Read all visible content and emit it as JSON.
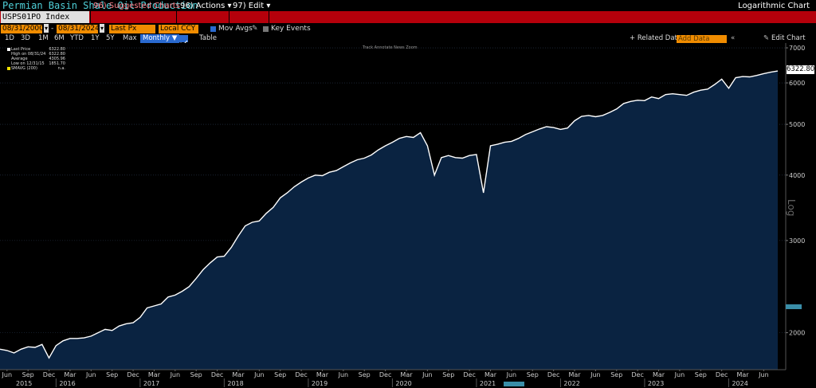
{
  "title": "Permian Basin Shale Oil Production",
  "command_bar": {
    "ticker": "USPS01PO Index",
    "suggested": "96) Suggested Charts",
    "actions": "96) Actions ▾",
    "edit": "97) Edit ▾",
    "mode": "Logarithmic Chart"
  },
  "controls": {
    "start_date": "08/31/2000",
    "end_date": "08/31/2024",
    "field": "Last Px",
    "currency": "Local CCY",
    "mov_avgs": "Mov Avgs",
    "key_events": "Key Events",
    "related_data": "+ Related Dat",
    "add_data_placeholder": "Add Data",
    "edit_chart": "Edit Chart"
  },
  "periods": [
    "1D",
    "3D",
    "1M",
    "6M",
    "YTD",
    "1Y",
    "5Y",
    "Max"
  ],
  "frequency": "Monthly ▼",
  "table_label": "Table",
  "mini_toolbar": "Track   Annotate   News   Zoom",
  "legend": {
    "rows": [
      {
        "label": "Last Price",
        "value": "6322.80"
      },
      {
        "label": "High on 08/31/24",
        "value": "6322.80"
      },
      {
        "label": "Average",
        "value": "4305.96"
      },
      {
        "label": "Low on 12/31/15",
        "value": "1851.70"
      },
      {
        "label": "SMAVG (200)",
        "value": "n.a."
      }
    ]
  },
  "last_value_label": "6322.80",
  "axis_side_label": "Log",
  "colors": {
    "area_fill": "#0a2341",
    "line": "#ffffff",
    "command_bar": "#b5000b",
    "orange_field": "#f08c00",
    "title": "#4fd0d8"
  },
  "chart_data": {
    "type": "area",
    "scale": "log",
    "title": "Permian Basin Shale Oil Production",
    "ylim": [
      1700,
      7100
    ],
    "yticks": [
      2000,
      3000,
      4000,
      5000,
      6000,
      7000
    ],
    "month_labels": [
      "Jun",
      "Sep",
      "Dec",
      "Mar",
      "Jun",
      "Sep",
      "Dec",
      "Mar",
      "Jun",
      "Sep",
      "Dec",
      "Mar",
      "Jun",
      "Sep",
      "Dec",
      "Mar",
      "Jun",
      "Sep",
      "Dec",
      "Mar",
      "Jun",
      "Sep",
      "Dec",
      "Mar",
      "Jun",
      "Sep",
      "Dec",
      "Mar",
      "Jun",
      "Sep",
      "Dec",
      "Mar",
      "Jun",
      "Sep",
      "Dec",
      "Mar",
      "Jun"
    ],
    "year_labels": [
      "2015",
      "2016",
      "2017",
      "2018",
      "2019",
      "2020",
      "2021",
      "2022",
      "2023",
      "2024"
    ],
    "series": [
      {
        "points": [
          [
            "2015-05",
            1860
          ],
          [
            "2015-06",
            1850
          ],
          [
            "2015-07",
            1830
          ],
          [
            "2015-08",
            1860
          ],
          [
            "2015-09",
            1880
          ],
          [
            "2015-10",
            1875
          ],
          [
            "2015-11",
            1900
          ],
          [
            "2015-12",
            1790
          ],
          [
            "2016-01",
            1890
          ],
          [
            "2016-02",
            1930
          ],
          [
            "2016-03",
            1950
          ],
          [
            "2016-04",
            1950
          ],
          [
            "2016-05",
            1955
          ],
          [
            "2016-06",
            1970
          ],
          [
            "2016-07",
            2000
          ],
          [
            "2016-08",
            2030
          ],
          [
            "2016-09",
            2020
          ],
          [
            "2016-10",
            2060
          ],
          [
            "2016-11",
            2080
          ],
          [
            "2016-12",
            2090
          ],
          [
            "2017-01",
            2140
          ],
          [
            "2017-02",
            2230
          ],
          [
            "2017-03",
            2250
          ],
          [
            "2017-04",
            2270
          ],
          [
            "2017-05",
            2340
          ],
          [
            "2017-06",
            2360
          ],
          [
            "2017-07",
            2400
          ],
          [
            "2017-08",
            2450
          ],
          [
            "2017-09",
            2540
          ],
          [
            "2017-10",
            2640
          ],
          [
            "2017-11",
            2720
          ],
          [
            "2017-12",
            2790
          ],
          [
            "2018-01",
            2800
          ],
          [
            "2018-02",
            2910
          ],
          [
            "2018-03",
            3060
          ],
          [
            "2018-04",
            3200
          ],
          [
            "2018-05",
            3250
          ],
          [
            "2018-06",
            3270
          ],
          [
            "2018-07",
            3380
          ],
          [
            "2018-08",
            3470
          ],
          [
            "2018-09",
            3620
          ],
          [
            "2018-10",
            3700
          ],
          [
            "2018-11",
            3800
          ],
          [
            "2018-12",
            3880
          ],
          [
            "2019-01",
            3950
          ],
          [
            "2019-02",
            4000
          ],
          [
            "2019-03",
            3990
          ],
          [
            "2019-04",
            4050
          ],
          [
            "2019-05",
            4080
          ],
          [
            "2019-06",
            4150
          ],
          [
            "2019-07",
            4220
          ],
          [
            "2019-08",
            4280
          ],
          [
            "2019-09",
            4310
          ],
          [
            "2019-10",
            4370
          ],
          [
            "2019-11",
            4470
          ],
          [
            "2019-12",
            4550
          ],
          [
            "2020-01",
            4620
          ],
          [
            "2020-02",
            4700
          ],
          [
            "2020-03",
            4740
          ],
          [
            "2020-04",
            4720
          ],
          [
            "2020-05",
            4820
          ],
          [
            "2020-06",
            4550
          ],
          [
            "2020-07",
            4000
          ],
          [
            "2020-08",
            4320
          ],
          [
            "2020-09",
            4360
          ],
          [
            "2020-10",
            4320
          ],
          [
            "2020-11",
            4310
          ],
          [
            "2020-12",
            4360
          ],
          [
            "2021-01",
            4380
          ],
          [
            "2021-02",
            3700
          ],
          [
            "2021-03",
            4550
          ],
          [
            "2021-04",
            4580
          ],
          [
            "2021-05",
            4620
          ],
          [
            "2021-06",
            4640
          ],
          [
            "2021-07",
            4700
          ],
          [
            "2021-08",
            4780
          ],
          [
            "2021-09",
            4840
          ],
          [
            "2021-10",
            4900
          ],
          [
            "2021-11",
            4950
          ],
          [
            "2021-12",
            4930
          ],
          [
            "2022-01",
            4890
          ],
          [
            "2022-02",
            4920
          ],
          [
            "2022-03",
            5080
          ],
          [
            "2022-04",
            5180
          ],
          [
            "2022-05",
            5200
          ],
          [
            "2022-06",
            5170
          ],
          [
            "2022-07",
            5200
          ],
          [
            "2022-08",
            5270
          ],
          [
            "2022-09",
            5350
          ],
          [
            "2022-10",
            5480
          ],
          [
            "2022-11",
            5530
          ],
          [
            "2022-12",
            5560
          ],
          [
            "2023-01",
            5550
          ],
          [
            "2023-02",
            5640
          ],
          [
            "2023-03",
            5600
          ],
          [
            "2023-04",
            5700
          ],
          [
            "2023-05",
            5720
          ],
          [
            "2023-06",
            5700
          ],
          [
            "2023-07",
            5680
          ],
          [
            "2023-08",
            5760
          ],
          [
            "2023-09",
            5810
          ],
          [
            "2023-10",
            5840
          ],
          [
            "2023-11",
            5960
          ],
          [
            "2023-12",
            6100
          ],
          [
            "2024-01",
            5860
          ],
          [
            "2024-02",
            6140
          ],
          [
            "2024-03",
            6170
          ],
          [
            "2024-04",
            6160
          ],
          [
            "2024-05",
            6200
          ],
          [
            "2024-06",
            6250
          ],
          [
            "2024-07",
            6290
          ],
          [
            "2024-08",
            6322.8
          ]
        ]
      }
    ]
  }
}
